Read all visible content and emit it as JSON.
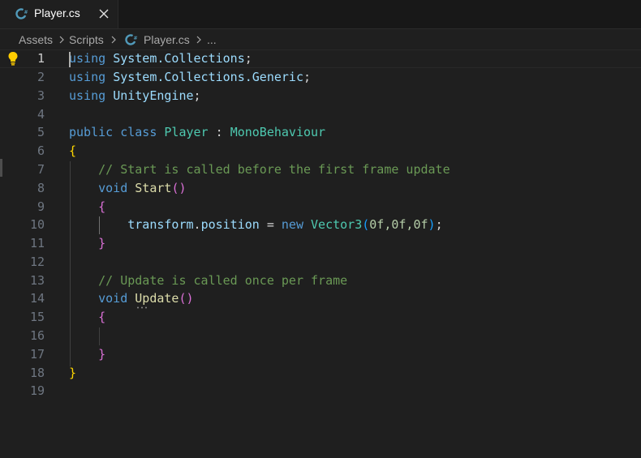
{
  "tab": {
    "label": "Player.cs",
    "icon": "csharp-file-icon",
    "close_icon": "close-icon"
  },
  "breadcrumb": {
    "items": [
      "Assets",
      "Scripts",
      "Player.cs",
      "..."
    ],
    "file_icon": "csharp-file-icon"
  },
  "editor": {
    "active_line": 1,
    "lines": [
      {
        "n": "1"
      },
      {
        "n": "2"
      },
      {
        "n": "3"
      },
      {
        "n": "4"
      },
      {
        "n": "5"
      },
      {
        "n": "6"
      },
      {
        "n": "7"
      },
      {
        "n": "8"
      },
      {
        "n": "9"
      },
      {
        "n": "10"
      },
      {
        "n": "11"
      },
      {
        "n": "12"
      },
      {
        "n": "13"
      },
      {
        "n": "14"
      },
      {
        "n": "15"
      },
      {
        "n": "16"
      },
      {
        "n": "17"
      },
      {
        "n": "18"
      },
      {
        "n": "19"
      }
    ],
    "tokens": {
      "using": "using",
      "ns1": "System.Collections",
      "ns2": "System.Collections.Generic",
      "ns3": "UnityEngine",
      "semi": ";",
      "public": "public",
      "class": "class",
      "player": "Player",
      "colon": " : ",
      "mono": "MonoBehaviour",
      "lbrace": "{",
      "rbrace": "}",
      "comment1": "// Start is called before the first frame update",
      "void": "void",
      "start": "Start",
      "parens_open": "(",
      "parens_close": ")",
      "transform": "transform",
      "dot": ".",
      "position": "position",
      "eq": " = ",
      "new": "new",
      "vector3": "Vector3",
      "args": "0f,0f,0f",
      "comment2": "// Update is called once per frame",
      "update": "Update"
    }
  },
  "colors": {
    "background": "#1f1f1f",
    "keyword": "#569cd6",
    "type": "#4ec9b0",
    "function": "#dcdcaa",
    "comment": "#6a9955",
    "bracket_gold": "#ffd700",
    "bracket_purple": "#da70d6",
    "bracket_blue": "#179fff"
  }
}
